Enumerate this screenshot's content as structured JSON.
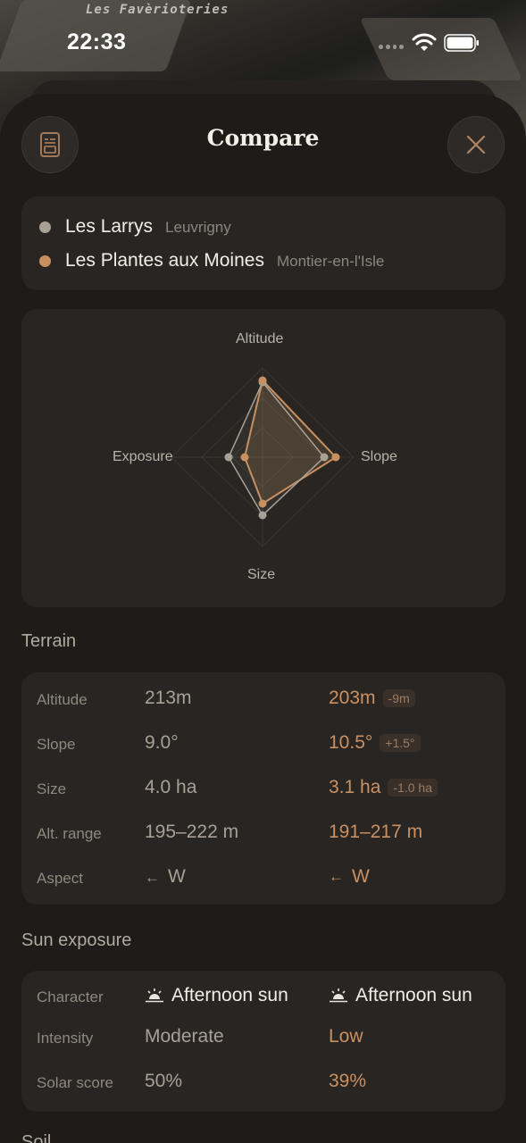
{
  "map": {
    "label": "Les Favèrioteries"
  },
  "status": {
    "time": "22:33"
  },
  "header": {
    "title": "Compare"
  },
  "parcels": [
    {
      "name": "Les Larrys",
      "place": "Leuvrigny",
      "color": "#a9a196"
    },
    {
      "name": "Les Plantes aux Moines",
      "place": "Montier-en-l'Isle",
      "color": "#c98f5f"
    }
  ],
  "radar": {
    "axes": [
      "Altitude",
      "Slope",
      "Size",
      "Exposure"
    ]
  },
  "terrain": {
    "title": "Terrain",
    "rows": [
      {
        "label": "Altitude",
        "a": "213m",
        "b": "203m",
        "delta": "-9m"
      },
      {
        "label": "Slope",
        "a": "9.0°",
        "b": "10.5°",
        "delta": "+1.5°"
      },
      {
        "label": "Size",
        "a": "4.0 ha",
        "b": "3.1 ha",
        "delta": "-1.0 ha"
      },
      {
        "label": "Alt. range",
        "a": "195–222 m",
        "b": "191–217 m"
      },
      {
        "label": "Aspect",
        "a_arrow": "←",
        "a": "W",
        "b_arrow": "←",
        "b": "W"
      }
    ]
  },
  "sun": {
    "title": "Sun exposure",
    "rows": [
      {
        "label": "Character",
        "a": "Afternoon sun",
        "b": "Afternoon sun"
      },
      {
        "label": "Intensity",
        "a": "Moderate",
        "b": "Low"
      },
      {
        "label": "Solar score",
        "a": "50%",
        "b": "39%"
      }
    ]
  },
  "next_section": {
    "title": "Soil"
  }
}
